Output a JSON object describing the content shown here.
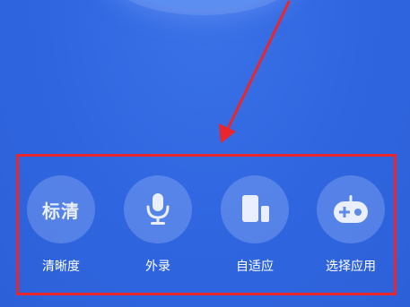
{
  "toolbar": {
    "items": [
      {
        "label": "清晰度",
        "icon_text": "标清",
        "icon": "hd-text-icon"
      },
      {
        "label": "外录",
        "icon": "microphone-icon"
      },
      {
        "label": "自适应",
        "icon": "adaptive-screen-icon"
      },
      {
        "label": "选择应用",
        "icon": "gamepad-icon"
      }
    ]
  },
  "colors": {
    "background": "#2f66e0",
    "highlight_border": "#e8262b",
    "arrow": "#e8262b",
    "icon": "#e9efff",
    "label": "#ffffff"
  }
}
